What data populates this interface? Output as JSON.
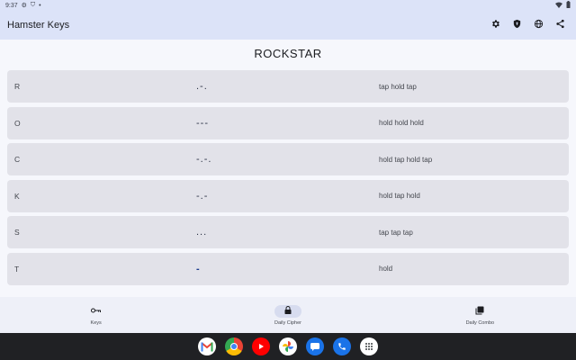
{
  "status_bar": {
    "time": "9:37"
  },
  "app_bar": {
    "title": "Hamster Keys",
    "actions": [
      "gear-icon",
      "shield-icon",
      "globe-icon",
      "share-icon"
    ]
  },
  "cipher": {
    "word": "ROCKSTAR",
    "rows": [
      {
        "letter": "R",
        "morse": ".-.",
        "description": "tap hold tap"
      },
      {
        "letter": "O",
        "morse": "---",
        "description": "hold hold hold"
      },
      {
        "letter": "C",
        "morse": "-.-.",
        "description": "hold tap hold tap"
      },
      {
        "letter": "K",
        "morse": "-.-",
        "description": "hold tap hold"
      },
      {
        "letter": "S",
        "morse": "...",
        "description": "tap tap tap"
      },
      {
        "letter": "T",
        "morse": "-",
        "description": "hold"
      }
    ]
  },
  "bottom_nav": {
    "items": [
      {
        "label": "Keys",
        "icon": "key-icon",
        "active": false
      },
      {
        "label": "Daily Cipher",
        "icon": "lock-icon",
        "active": true
      },
      {
        "label": "Daily Combo",
        "icon": "cards-icon",
        "active": false
      }
    ]
  },
  "dock": [
    "gmail-icon",
    "chrome-icon",
    "youtube-icon",
    "photos-icon",
    "messages-icon",
    "phone-icon",
    "apps-icon"
  ],
  "colors": {
    "app_bar": "#dce3f8",
    "row_bg": "#e2e2e9",
    "accent": "#1a3b8c",
    "nav_active": "#d7dcef"
  }
}
